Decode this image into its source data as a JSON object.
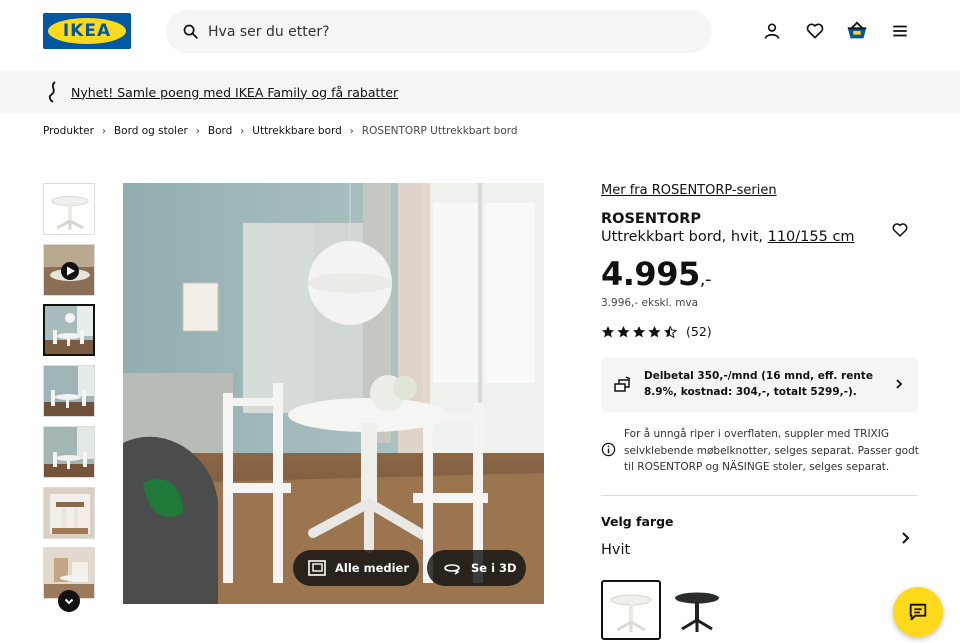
{
  "header": {
    "logo_text": "IKEA",
    "search_placeholder": "Hva ser du etter?",
    "icons": [
      "user-icon",
      "heart-icon",
      "cart-icon",
      "menu-icon"
    ]
  },
  "banner": {
    "text": "Nyhet! Samle poeng med IKEA Family og få rabatter"
  },
  "breadcrumb": [
    "Produkter",
    "Bord og stoler",
    "Bord",
    "Uttrekkbare bord",
    "ROSENTORP Uttrekkbart bord"
  ],
  "gallery": {
    "all_media_label": "Alle medier",
    "view_3d_label": "Se i 3D"
  },
  "product": {
    "series_link": "Mer fra ROSENTORP-serien",
    "name": "ROSENTORP",
    "description": "Uttrekkbart bord, hvit,",
    "size": "110/155 cm",
    "price_main": "4.995",
    "price_suffix": ",-",
    "price_ex_vat": "3.996,- ekskl. mva",
    "rating_value": 4.5,
    "rating_count": "(52)",
    "finance_text": "Delbetal 350,-/mnd (16 mnd, eff. rente 8.9%, kostnad: 304,-, totalt 5299,-).",
    "info_text": "For å unngå riper i overflaten, suppler med TRIXIG selvklebende møbelknotter, selges separat. Passer godt til ROSENTORP og NÄSINGE stoler, selges separat.",
    "color_title": "Velg farge",
    "color_value": "Hvit"
  },
  "colors": {
    "accent_yellow": "#ffda1a",
    "ikea_blue": "#0058a3",
    "panel_grey": "#f5f5f5"
  }
}
